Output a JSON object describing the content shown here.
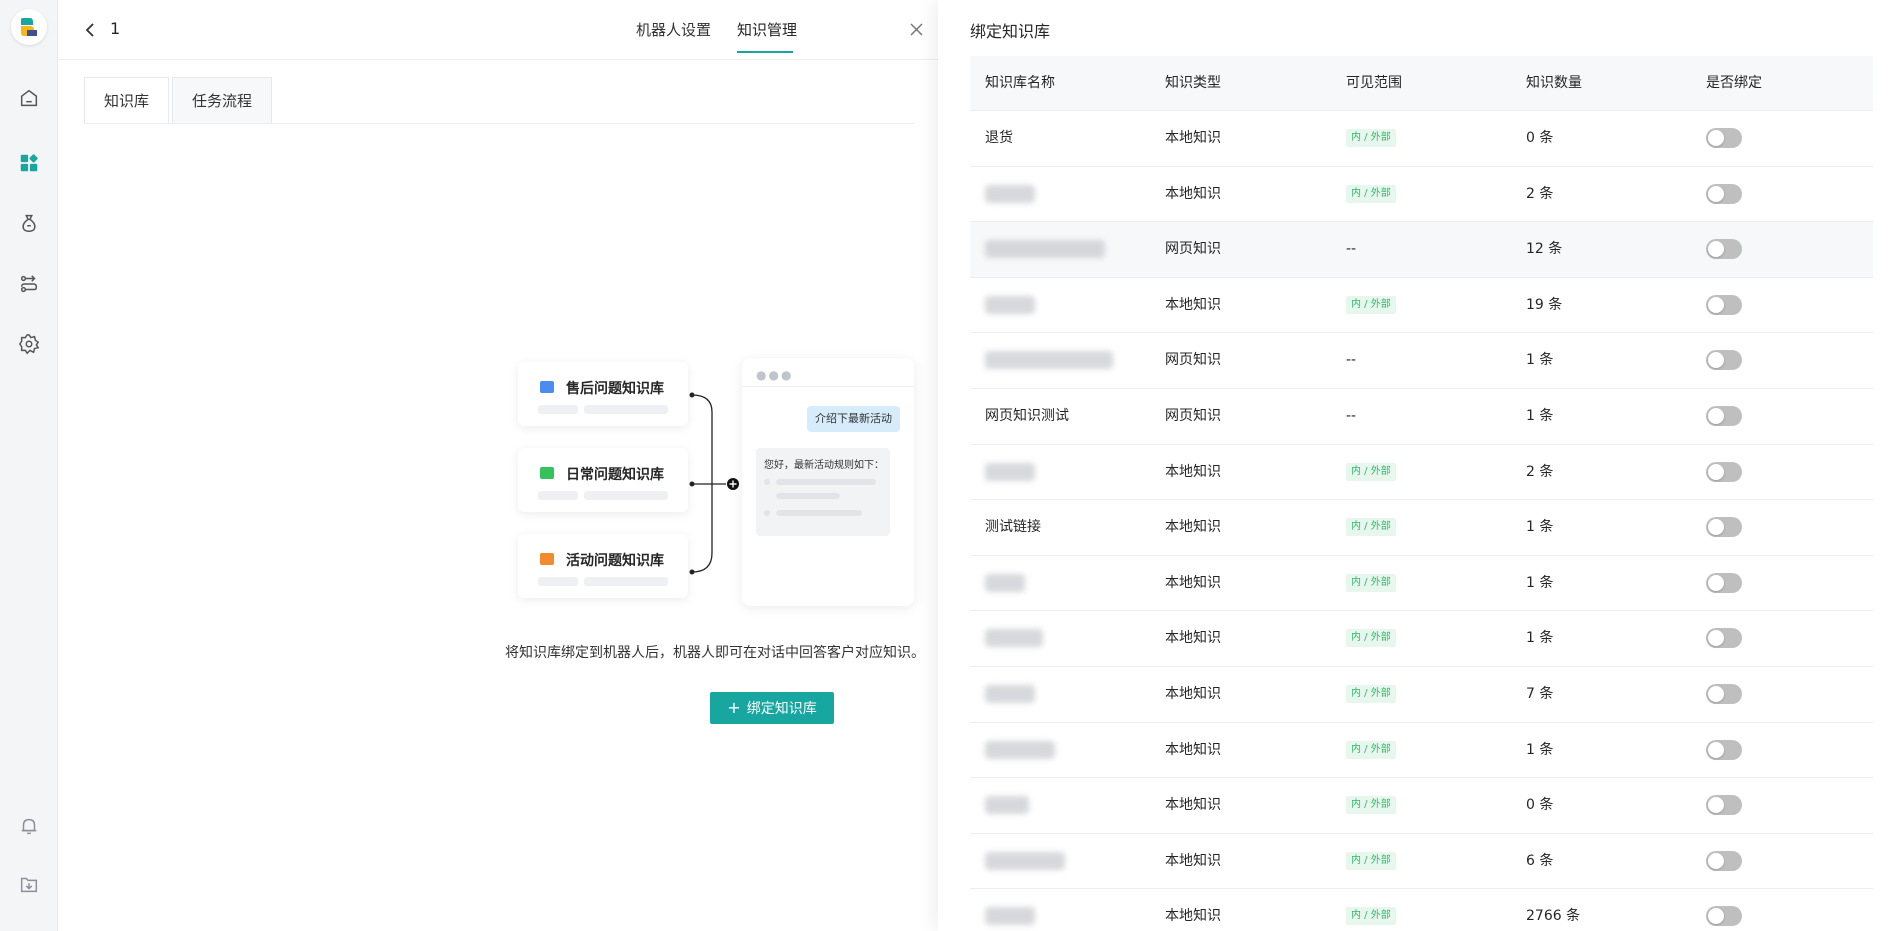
{
  "rail": {
    "items": [
      {
        "name": "home-icon"
      },
      {
        "name": "apps-icon"
      },
      {
        "name": "money-bag-icon"
      },
      {
        "name": "workflow-icon"
      },
      {
        "name": "settings-icon"
      },
      {
        "name": "bell-icon"
      },
      {
        "name": "download-icon"
      }
    ],
    "active_color": "#17a7a0"
  },
  "header": {
    "title": "1",
    "tabs": [
      {
        "label": "机器人设置",
        "active": false
      },
      {
        "label": "知识管理",
        "active": true
      }
    ]
  },
  "subtabs": [
    {
      "label": "知识库",
      "active": true
    },
    {
      "label": "任务流程",
      "active": false
    }
  ],
  "illustration": {
    "cards": [
      {
        "label": "售后问题知识库",
        "color": "#4a8cf0"
      },
      {
        "label": "日常问题知识库",
        "color": "#36c25a"
      },
      {
        "label": "活动问题知识库",
        "color": "#f28a2e"
      }
    ],
    "user_message": "介绍下最新活动",
    "bot_message": "您好，最新活动规则如下："
  },
  "empty_state": {
    "description": "将知识库绑定到机器人后，机器人即可在对话中回答客户对应知识。",
    "bind_button": "绑定知识库"
  },
  "drawer": {
    "title": "绑定知识库",
    "columns": [
      "知识库名称",
      "知识类型",
      "可见范围",
      "知识数量",
      "是否绑定"
    ],
    "rows": [
      {
        "name": "退货",
        "type": "本地知识",
        "scope": "内 / 外部",
        "count": "0 条",
        "bound": false
      },
      {
        "name": "",
        "type": "本地知识",
        "scope": "内 / 外部",
        "count": "2 条",
        "bound": false
      },
      {
        "name": "",
        "type": "网页知识",
        "scope": "--",
        "count": "12 条",
        "bound": false
      },
      {
        "name": "",
        "type": "本地知识",
        "scope": "内 / 外部",
        "count": "19 条",
        "bound": false
      },
      {
        "name": "",
        "type": "网页知识",
        "scope": "--",
        "count": "1 条",
        "bound": false
      },
      {
        "name": "网页知识测试",
        "type": "网页知识",
        "scope": "--",
        "count": "1 条",
        "bound": false
      },
      {
        "name": "",
        "type": "本地知识",
        "scope": "内 / 外部",
        "count": "2 条",
        "bound": false
      },
      {
        "name": "测试链接",
        "type": "本地知识",
        "scope": "内 / 外部",
        "count": "1 条",
        "bound": false
      },
      {
        "name": "",
        "type": "本地知识",
        "scope": "内 / 外部",
        "count": "1 条",
        "bound": false
      },
      {
        "name": "",
        "type": "本地知识",
        "scope": "内 / 外部",
        "count": "1 条",
        "bound": false
      },
      {
        "name": "",
        "type": "本地知识",
        "scope": "内 / 外部",
        "count": "7 条",
        "bound": false
      },
      {
        "name": "",
        "type": "本地知识",
        "scope": "内 / 外部",
        "count": "1 条",
        "bound": false
      },
      {
        "name": "",
        "type": "本地知识",
        "scope": "内 / 外部",
        "count": "0 条",
        "bound": false
      },
      {
        "name": "",
        "type": "本地知识",
        "scope": "内 / 外部",
        "count": "6 条",
        "bound": false
      },
      {
        "name": "",
        "type": "本地知识",
        "scope": "内 / 外部",
        "count": "2766 条",
        "bound": false
      }
    ]
  }
}
